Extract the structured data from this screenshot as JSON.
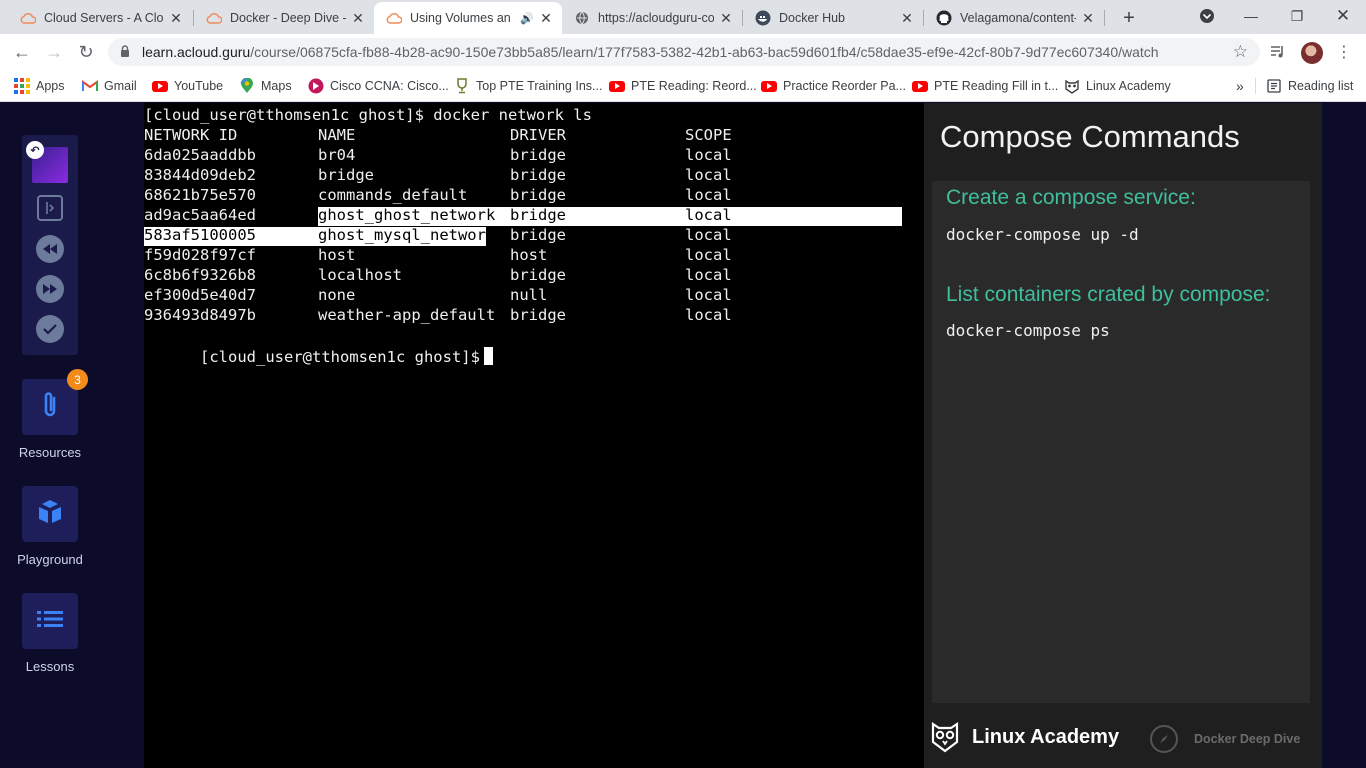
{
  "browser": {
    "tabs": [
      {
        "title": "Cloud Servers - A Clou",
        "icon": "cloud-guru-icon"
      },
      {
        "title": "Docker - Deep Dive - A",
        "icon": "cloud-guru-icon"
      },
      {
        "title": "Using Volumes an",
        "icon": "cloud-guru-icon",
        "active": true,
        "audio": true
      },
      {
        "title": "https://acloudguru-co",
        "icon": "globe-icon"
      },
      {
        "title": "Docker Hub",
        "icon": "docker-icon"
      },
      {
        "title": "Velagamona/content-",
        "icon": "github-icon"
      }
    ],
    "url_host": "learn.acloud.guru",
    "url_path": "/course/06875cfa-fb88-4b28-ac90-150e73bb5a85/learn/177f7583-5382-42b1-ab63-bac59d601fb4/c58dae35-ef9e-42cf-80b7-9d77ec607340/watch",
    "bookmarks": [
      {
        "label": "Apps",
        "icon": "apps-grid-icon"
      },
      {
        "label": "Gmail",
        "icon": "gmail-icon"
      },
      {
        "label": "YouTube",
        "icon": "youtube-icon"
      },
      {
        "label": "Maps",
        "icon": "maps-icon"
      },
      {
        "label": "Cisco CCNA: Cisco...",
        "icon": "cisco-icon"
      },
      {
        "label": "Top PTE Training Ins...",
        "icon": "trophy-icon"
      },
      {
        "label": "PTE Reading: Reord...",
        "icon": "youtube-icon"
      },
      {
        "label": "Practice Reorder Pa...",
        "icon": "youtube-icon"
      },
      {
        "label": "PTE Reading Fill in t...",
        "icon": "youtube-icon"
      },
      {
        "label": "Linux Academy",
        "icon": "linux-academy-icon"
      }
    ],
    "reading_list": "Reading list",
    "more_bookmarks": "»"
  },
  "sidebar": {
    "resources_label": "Resources",
    "resources_badge": "3",
    "playground_label": "Playground",
    "lessons_label": "Lessons"
  },
  "terminal": {
    "command_line": "[cloud_user@tthomsen1c ghost]$ docker network ls",
    "headers": [
      "NETWORK ID",
      "NAME",
      "DRIVER",
      "SCOPE"
    ],
    "rows": [
      [
        "6da025aaddbb",
        "br04",
        "bridge",
        "local"
      ],
      [
        "83844d09deb2",
        "bridge",
        "bridge",
        "local"
      ],
      [
        "68621b75e570",
        "commands_default",
        "bridge",
        "local"
      ],
      [
        "ad9ac5aa64ed",
        "ghost_ghost_network",
        "bridge",
        "local"
      ],
      [
        "583af5100005",
        "ghost_mysql_network",
        "bridge",
        "local"
      ],
      [
        "f59d028f97cf",
        "host",
        "host",
        "local"
      ],
      [
        "6c8b6f9326b8",
        "localhost",
        "bridge",
        "local"
      ],
      [
        "ef300d5e40d7",
        "none",
        "null",
        "local"
      ],
      [
        "936493d8497b",
        "weather-app_default",
        "bridge",
        "local"
      ]
    ],
    "prompt": "[cloud_user@tthomsen1c ghost]$"
  },
  "slide": {
    "title": "Compose Commands",
    "items": [
      {
        "heading": "Create a compose service:",
        "command": "docker-compose up -d"
      },
      {
        "heading": "List containers crated by compose:",
        "command": "docker-compose ps"
      }
    ],
    "brand": "Linux Academy",
    "course": "Docker Deep Dive",
    "accent": "#3fbf9a"
  }
}
